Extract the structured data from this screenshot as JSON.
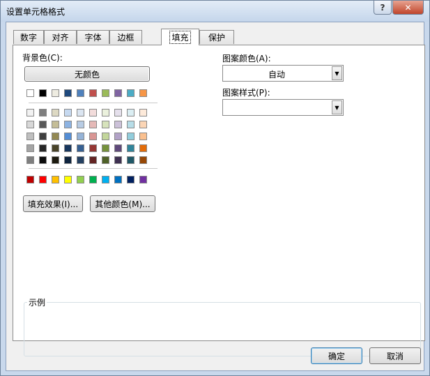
{
  "window": {
    "title": "设置单元格格式",
    "help_label": "?",
    "close_label": "✕"
  },
  "tabs": [
    {
      "label": "数字",
      "active": false
    },
    {
      "label": "对齐",
      "active": false
    },
    {
      "label": "字体",
      "active": false
    },
    {
      "label": "边框",
      "active": false
    },
    {
      "label": "填充",
      "active": true
    },
    {
      "label": "保护",
      "active": false
    }
  ],
  "fill": {
    "background_label": "背景色(C):",
    "no_color_button": "无颜色",
    "fill_effects_button": "填充效果(I)...",
    "more_colors_button": "其他颜色(M)...",
    "pattern_color_label": "图案颜色(A):",
    "pattern_color_value": "自动",
    "pattern_style_label": "图案样式(P):",
    "pattern_style_value": "",
    "sample_label": "示例"
  },
  "palette": {
    "theme_row": [
      "#ffffff",
      "#000000",
      "#eeece1",
      "#1f497d",
      "#4f81bd",
      "#c0504d",
      "#9bbb59",
      "#8064a2",
      "#4bacc6",
      "#f79646"
    ],
    "tint_rows": [
      [
        "#f2f2f2",
        "#7f7f7f",
        "#ddd9c3",
        "#c6d9f0",
        "#dbe5f1",
        "#f2dcdb",
        "#ebf1dd",
        "#e5e0ec",
        "#dbeef3",
        "#fdeada"
      ],
      [
        "#d8d8d8",
        "#595959",
        "#c4bd97",
        "#8db3e2",
        "#b8cce4",
        "#e5b9b7",
        "#d7e3bc",
        "#ccc1d9",
        "#b7dde8",
        "#fbd5b5"
      ],
      [
        "#bfbfbf",
        "#3f3f3f",
        "#938953",
        "#548dd4",
        "#95b3d7",
        "#d99694",
        "#c3d69b",
        "#b2a2c7",
        "#92cddc",
        "#fac08f"
      ],
      [
        "#a5a5a5",
        "#262626",
        "#494429",
        "#17365d",
        "#366092",
        "#953734",
        "#76923c",
        "#5f497a",
        "#31859b",
        "#e36c09"
      ],
      [
        "#7f7f7f",
        "#0c0c0c",
        "#1d1b10",
        "#0f243e",
        "#244061",
        "#632423",
        "#4f6128",
        "#3f3151",
        "#205867",
        "#974806"
      ]
    ],
    "standard_row": [
      "#c00000",
      "#ff0000",
      "#ffc000",
      "#ffff00",
      "#92d050",
      "#00b050",
      "#00b0f0",
      "#0070c0",
      "#002060",
      "#7030a0"
    ]
  },
  "footer": {
    "ok_button": "确定",
    "cancel_button": "取消"
  }
}
